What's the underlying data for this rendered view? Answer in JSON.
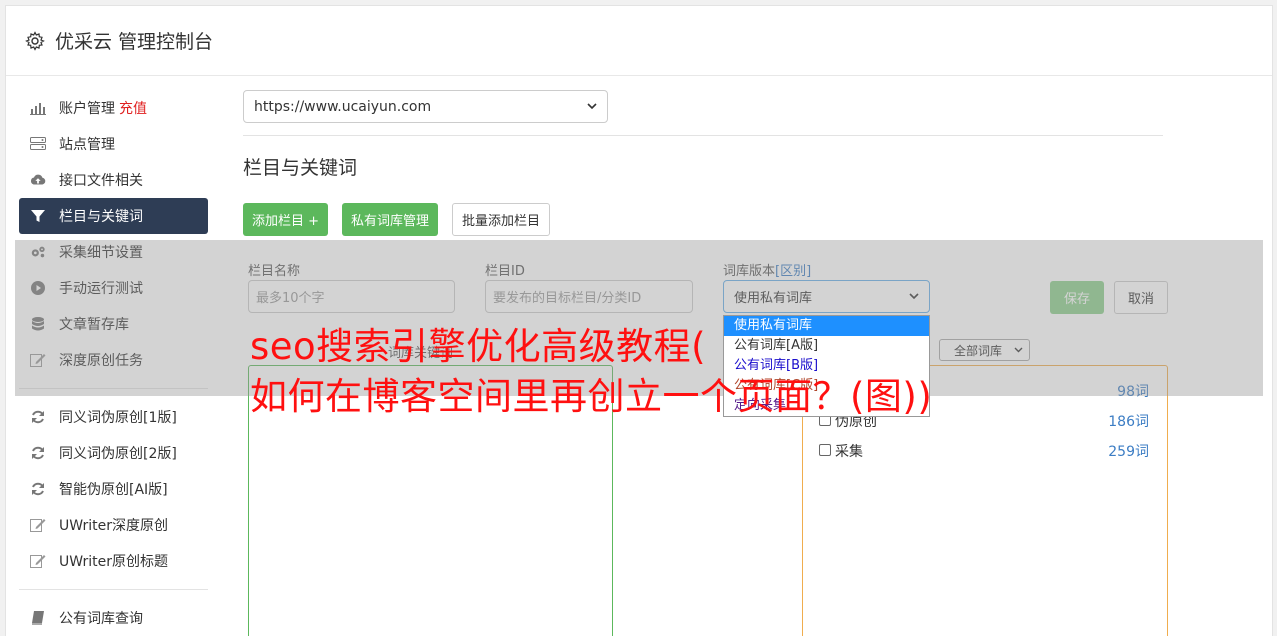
{
  "header": {
    "title": "优采云 管理控制台",
    "icon": "gear-icon"
  },
  "sidebar": {
    "items": [
      {
        "label": "账户管理",
        "badge": "充值",
        "icon": "bar-chart-icon"
      },
      {
        "label": "站点管理",
        "icon": "server-icon"
      },
      {
        "label": "接口文件相关",
        "icon": "cloud-upload-icon"
      },
      {
        "label": "栏目与关键词",
        "icon": "filter-icon",
        "active": true
      },
      {
        "label": "采集细节设置",
        "icon": "cogs-icon"
      },
      {
        "label": "手动运行测试",
        "icon": "play-circle-icon"
      },
      {
        "label": "文章暂存库",
        "icon": "database-icon"
      },
      {
        "label": "深度原创任务",
        "icon": "edit-icon"
      }
    ],
    "items2": [
      {
        "label": "同义词伪原创[1版]",
        "icon": "refresh-icon"
      },
      {
        "label": "同义词伪原创[2版]",
        "icon": "refresh-icon"
      },
      {
        "label": "智能伪原创[AI版]",
        "icon": "refresh-icon"
      },
      {
        "label": "UWriter深度原创",
        "icon": "edit-icon"
      },
      {
        "label": "UWriter原创标题",
        "icon": "edit-icon"
      }
    ],
    "items3": [
      {
        "label": "公有词库查询",
        "icon": "book-icon"
      }
    ]
  },
  "main": {
    "site_select": "https://www.ucaiyun.com",
    "section_title": "栏目与关键词",
    "buttons": {
      "add_column": "添加栏目 +",
      "private_lib": "私有词库管理",
      "batch_add": "批量添加栏目"
    },
    "form": {
      "name_label": "栏目名称",
      "name_placeholder": "最多10个字",
      "id_label": "栏目ID",
      "id_placeholder": "要发布的目标栏目/分类ID",
      "lib_label": "词库版本",
      "lib_label_link": "[区别]",
      "lib_value": "使用私有词库",
      "save": "保存",
      "cancel": "取消"
    },
    "dropdown_options": [
      "使用私有词库",
      "公有词库[A版]",
      "公有词库[B版]",
      "公有词库[C版]",
      "定向采集"
    ],
    "lib_filter": "全部词库",
    "left_box_label": "词库关键词",
    "libraries": [
      {
        "name": "",
        "count": "98词"
      },
      {
        "name": "伪原创",
        "count": "186词"
      },
      {
        "name": "采集",
        "count": "259词"
      }
    ]
  },
  "overlay": {
    "line1": "seo搜索引擎优化高级教程(",
    "line2": "如何在博客空间里再创立一个页面？(图))"
  }
}
